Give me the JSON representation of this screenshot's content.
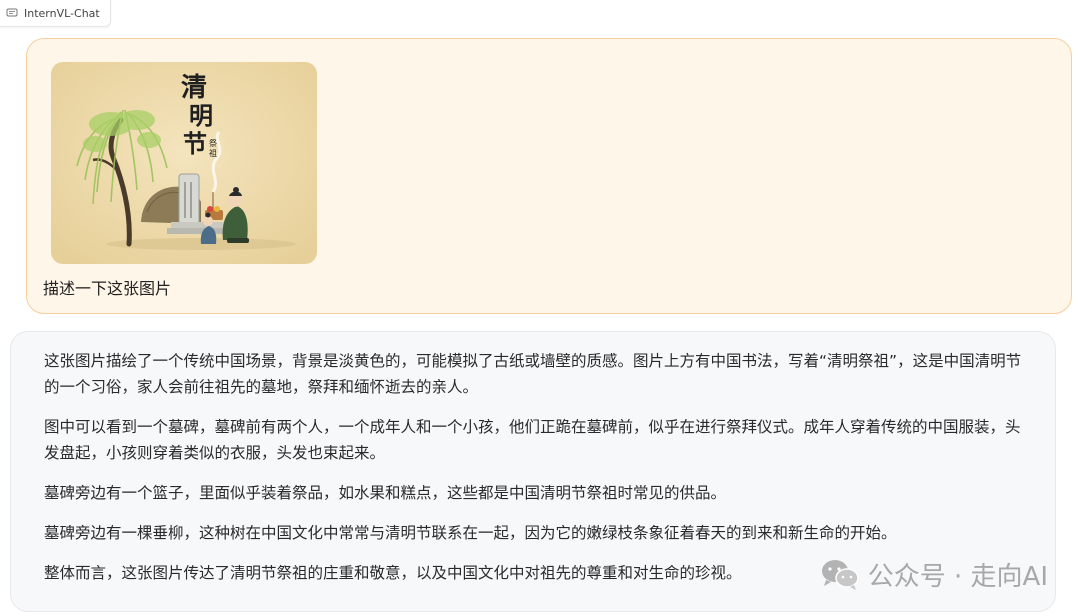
{
  "tab": {
    "title": "InternVL-Chat",
    "icon": "chat-bubble-icon"
  },
  "user_message": {
    "image": {
      "calligraphy": "清明节",
      "calligraphy_small": "祭祖"
    },
    "text": "描述一下这张图片"
  },
  "assistant_message": {
    "paragraphs": [
      "这张图片描绘了一个传统中国场景，背景是淡黄色的，可能模拟了古纸或墙壁的质感。图片上方有中国书法，写着“清明祭祖”，这是中国清明节的一个习俗，家人会前往祖先的墓地，祭拜和缅怀逝去的亲人。",
      "图中可以看到一个墓碑，墓碑前有两个人，一个成年人和一个小孩，他们正跪在墓碑前，似乎在进行祭拜仪式。成年人穿着传统的中国服装，头发盘起，小孩则穿着类似的衣服，头发也束起来。",
      "墓碑旁边有一个篮子，里面似乎装着祭品，如水果和糕点，这些都是中国清明节祭祖时常见的供品。",
      "墓碑旁边有一棵垂柳，这种树在中国文化中常常与清明节联系在一起，因为它的嫩绿枝条象征着春天的到来和新生命的开始。",
      "整体而言，这张图片传达了清明节祭祖的庄重和敬意，以及中国文化中对祖先的尊重和对生命的珍视。"
    ]
  },
  "watermark": {
    "text": "公众号 · 走向AI",
    "icon": "wechat-icon"
  },
  "colors": {
    "user_bg": "#fff6ea",
    "user_border": "#f5cf9c",
    "bot_bg": "#f7f8fa",
    "image_bg": "#efdcae"
  }
}
